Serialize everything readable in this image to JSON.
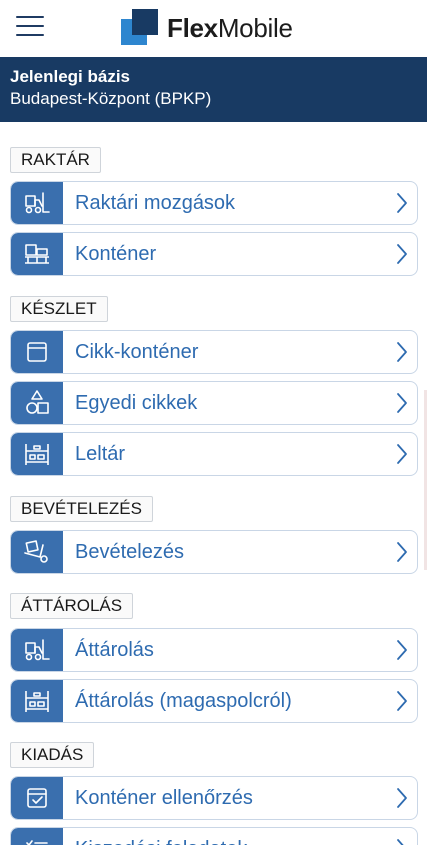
{
  "header": {
    "logo_bold": "Flex",
    "logo_regular": "Mobile"
  },
  "base": {
    "title": "Jelenlegi bázis",
    "value": "Budapest-Központ (BPKP)"
  },
  "sections": {
    "raktar": {
      "label": "RAKTÁR",
      "items": [
        {
          "label": "Raktári mozgások",
          "icon": "forklift-icon"
        },
        {
          "label": "Konténer",
          "icon": "pallet-boxes-icon"
        }
      ]
    },
    "keszlet": {
      "label": "KÉSZLET",
      "items": [
        {
          "label": "Cikk-konténer",
          "icon": "box-icon"
        },
        {
          "label": "Egyedi cikkek",
          "icon": "shapes-icon"
        },
        {
          "label": "Leltár",
          "icon": "shelf-icon"
        }
      ]
    },
    "bevetelezes": {
      "label": "BEVÉTELEZÉS",
      "items": [
        {
          "label": "Bevételezés",
          "icon": "hand-truck-icon"
        }
      ]
    },
    "attarolas": {
      "label": "ÁTTÁROLÁS",
      "items": [
        {
          "label": "Áttárolás",
          "icon": "forklift-icon"
        },
        {
          "label": "Áttárolás (magaspolcról)",
          "icon": "high-shelf-icon"
        }
      ]
    },
    "kiadas": {
      "label": "KIADÁS",
      "items": [
        {
          "label": "Konténer ellenőrzés",
          "icon": "box-check-icon"
        },
        {
          "label": "Kiszedési feladatok",
          "icon": "checklist-icon"
        }
      ]
    }
  },
  "colors": {
    "header_band": "#183a63",
    "accent": "#3a6fae",
    "link_text": "#2e6bb0"
  }
}
